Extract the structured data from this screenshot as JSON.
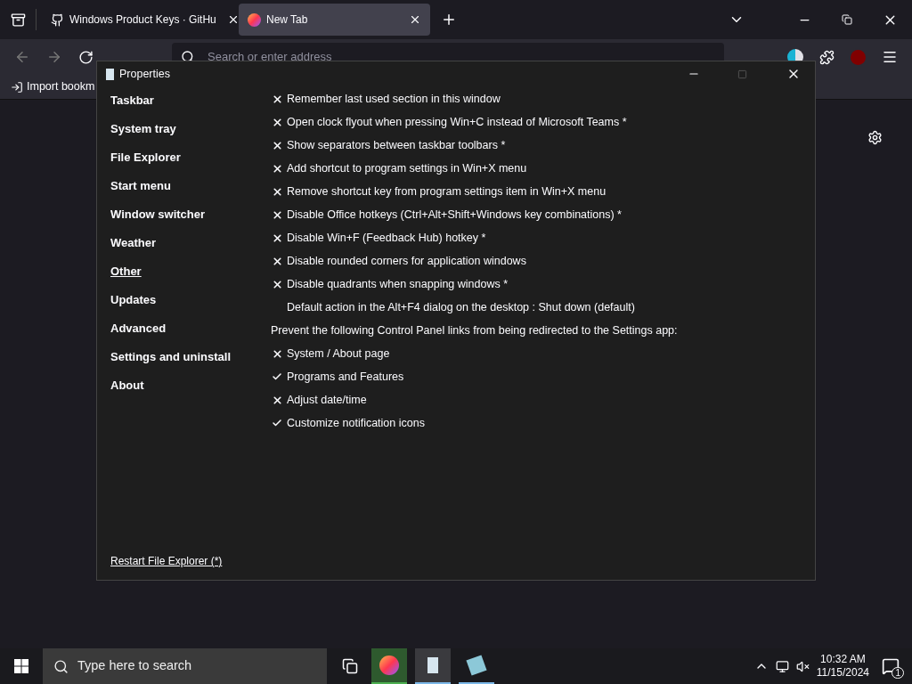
{
  "browser": {
    "tabs": [
      {
        "title": "Windows Product Keys · GitHu",
        "selected": false
      },
      {
        "title": "New Tab",
        "selected": true
      }
    ],
    "address": {
      "placeholder": "Search or enter address"
    },
    "bookmarks": [
      "Import bookm"
    ]
  },
  "window": {
    "title": "Properties",
    "sidebar": {
      "items": [
        {
          "label": "Taskbar",
          "selected": false
        },
        {
          "label": "System tray",
          "selected": false
        },
        {
          "label": "File Explorer",
          "selected": false
        },
        {
          "label": "Start menu",
          "selected": false
        },
        {
          "label": "Window switcher",
          "selected": false
        },
        {
          "label": "Weather",
          "selected": false
        },
        {
          "label": "Other",
          "selected": true
        },
        {
          "label": "Updates",
          "selected": false
        },
        {
          "label": "Advanced",
          "selected": false
        },
        {
          "label": "Settings and uninstall",
          "selected": false
        },
        {
          "label": "About",
          "selected": false
        }
      ],
      "footer_link": "Restart File Explorer (*)"
    },
    "options": [
      {
        "kind": "toggle",
        "label": "Remember last used section in this window",
        "checked": false
      },
      {
        "kind": "toggle",
        "label": "Open clock flyout when pressing Win+C instead of Microsoft Teams *",
        "checked": false
      },
      {
        "kind": "toggle",
        "label": "Show separators between taskbar toolbars *",
        "checked": false
      },
      {
        "kind": "toggle",
        "label": "Add shortcut to program settings in Win+X menu",
        "checked": false
      },
      {
        "kind": "toggle",
        "label": "Remove shortcut key from program settings item in Win+X menu",
        "checked": false
      },
      {
        "kind": "toggle",
        "label": "Disable Office hotkeys (Ctrl+Alt+Shift+Windows key combinations) *",
        "checked": false
      },
      {
        "kind": "toggle",
        "label": "Disable Win+F (Feedback Hub) hotkey *",
        "checked": false
      },
      {
        "kind": "toggle",
        "label": "Disable rounded corners for application windows",
        "checked": false
      },
      {
        "kind": "toggle",
        "label": "Disable quadrants when snapping windows *",
        "checked": false
      },
      {
        "kind": "choice",
        "label": "Default action in the Alt+F4 dialog on the desktop : Shut down (default)"
      },
      {
        "kind": "heading",
        "label": "Prevent the following Control Panel links from being redirected to the Settings app:"
      },
      {
        "kind": "toggle",
        "label": "System / About page",
        "checked": false
      },
      {
        "kind": "toggle",
        "label": "Programs and Features",
        "checked": true
      },
      {
        "kind": "toggle",
        "label": "Adjust date/time",
        "checked": false
      },
      {
        "kind": "toggle",
        "label": "Customize notification icons",
        "checked": true
      }
    ]
  },
  "taskbar": {
    "search_placeholder": "Type here to search",
    "time": "10:32 AM",
    "date": "11/15/2024",
    "notifications": "1"
  }
}
